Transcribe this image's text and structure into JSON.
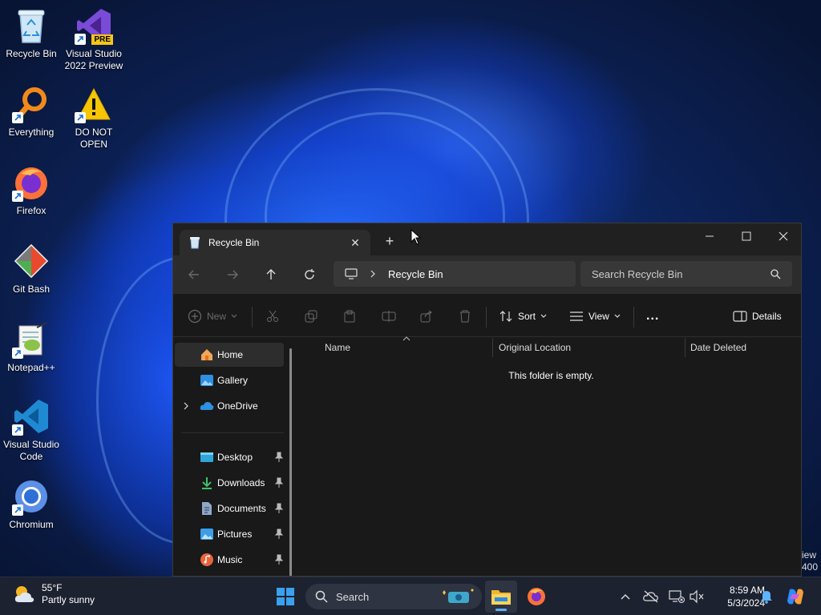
{
  "desktop": {
    "icons": [
      {
        "label": "Recycle Bin",
        "icon": "recycle-bin-icon"
      },
      {
        "label": "Visual Studio 2022 Preview",
        "icon": "visual-studio-icon",
        "badge": "PRE"
      },
      {
        "label": "Everything",
        "icon": "everything-search-icon"
      },
      {
        "label": "DO NOT OPEN",
        "icon": "warning-icon"
      },
      {
        "label": "Firefox",
        "icon": "firefox-icon"
      },
      {
        "label": "Git Bash",
        "icon": "git-bash-icon"
      },
      {
        "label": "Notepad++",
        "icon": "notepadpp-icon"
      },
      {
        "label": "Visual Studio Code",
        "icon": "vscode-icon"
      },
      {
        "label": "Chromium",
        "icon": "chromium-icon"
      }
    ],
    "edge_text": [
      "iew",
      "400"
    ]
  },
  "explorer": {
    "tab_title": "Recycle Bin",
    "address": {
      "crumb": "Recycle Bin"
    },
    "search_placeholder": "Search Recycle Bin",
    "toolbar": {
      "new": "New",
      "sort": "Sort",
      "view": "View",
      "more": "...",
      "details": "Details"
    },
    "nav": {
      "items": [
        {
          "label": "Home",
          "icon": "home-icon",
          "selected": true
        },
        {
          "label": "Gallery",
          "icon": "gallery-icon"
        },
        {
          "label": "OneDrive",
          "icon": "onedrive-icon",
          "expandable": true
        }
      ],
      "quick_access": [
        {
          "label": "Desktop",
          "icon": "desktop-folder-icon",
          "pinned": true
        },
        {
          "label": "Downloads",
          "icon": "downloads-icon",
          "pinned": true
        },
        {
          "label": "Documents",
          "icon": "documents-icon",
          "pinned": true
        },
        {
          "label": "Pictures",
          "icon": "pictures-icon",
          "pinned": true
        },
        {
          "label": "Music",
          "icon": "music-icon",
          "pinned": true
        }
      ]
    },
    "columns": [
      "Name",
      "Original Location",
      "Date Deleted"
    ],
    "empty_message": "This folder is empty."
  },
  "taskbar": {
    "weather": {
      "temp": "55°F",
      "condition": "Partly sunny"
    },
    "search_label": "Search",
    "clock": {
      "time": "8:59 AM",
      "date": "5/3/2024"
    }
  }
}
